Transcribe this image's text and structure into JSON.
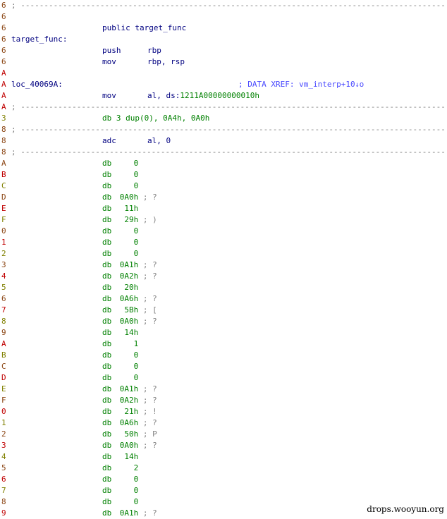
{
  "colors": {
    "seg_brown": "#8b4513",
    "seg_red": "#c00000",
    "seg_olive": "#808000",
    "text_navy": "#000080",
    "data_green": "#008000",
    "comment_blue": "#4a4aff",
    "separator_gray": "#808080"
  },
  "code_rows": [
    {
      "g": "6",
      "gc": "seg_brown",
      "sep": true
    },
    {
      "g": "6",
      "gc": "seg_brown"
    },
    {
      "g": "6",
      "gc": "seg_brown",
      "mn": "public target_func"
    },
    {
      "g": "6",
      "gc": "seg_brown",
      "label": "target_func:"
    },
    {
      "g": "6",
      "gc": "seg_brown",
      "mn": "push",
      "op": "rbp"
    },
    {
      "g": "6",
      "gc": "seg_brown",
      "mn": "mov",
      "op": "rbp, rsp"
    },
    {
      "g": "A",
      "gc": "seg_red"
    },
    {
      "g": "A",
      "gc": "seg_red",
      "label": "loc_40069A:",
      "comment": "; DATA XREF: vm_interp+10",
      "arrow": "↓",
      "comment_tail": "o"
    },
    {
      "g": "A",
      "gc": "seg_red",
      "mn": "mov",
      "op": "al, ds:",
      "opnum": "1211A00000000010h"
    },
    {
      "g": "A",
      "gc": "seg_red",
      "sep": true
    },
    {
      "g": "3",
      "gc": "seg_olive",
      "mn": "db 3 dup(0), 0A4h, 0A0h",
      "mncolor": "data_green"
    },
    {
      "g": "8",
      "gc": "seg_brown",
      "sep": true
    },
    {
      "g": "8",
      "gc": "seg_brown",
      "mn": "adc",
      "op": "al, 0"
    },
    {
      "g": "8",
      "gc": "seg_brown",
      "sep": true
    }
  ],
  "db_rows": [
    {
      "g": "A",
      "v": "0"
    },
    {
      "g": "B",
      "v": "0"
    },
    {
      "g": "C",
      "v": "0"
    },
    {
      "g": "D",
      "v": "0A0h",
      "c": "?"
    },
    {
      "g": "E",
      "v": "11h"
    },
    {
      "g": "F",
      "v": "29h",
      "c": ")"
    },
    {
      "g": "0",
      "v": "0"
    },
    {
      "g": "1",
      "v": "0"
    },
    {
      "g": "2",
      "v": "0"
    },
    {
      "g": "3",
      "v": "0A1h",
      "c": "?"
    },
    {
      "g": "4",
      "v": "0A2h",
      "c": "?"
    },
    {
      "g": "5",
      "v": "20h"
    },
    {
      "g": "6",
      "v": "0A6h",
      "c": "?"
    },
    {
      "g": "7",
      "v": "5Bh",
      "c": "["
    },
    {
      "g": "8",
      "v": "0A0h",
      "c": "?"
    },
    {
      "g": "9",
      "v": "14h"
    },
    {
      "g": "A",
      "v": "1"
    },
    {
      "g": "B",
      "v": "0"
    },
    {
      "g": "C",
      "v": "0"
    },
    {
      "g": "D",
      "v": "0"
    },
    {
      "g": "E",
      "v": "0A1h",
      "c": "?"
    },
    {
      "g": "F",
      "v": "0A2h",
      "c": "?"
    },
    {
      "g": "0",
      "v": "21h",
      "c": "!"
    },
    {
      "g": "1",
      "v": "0A6h",
      "c": "?"
    },
    {
      "g": "2",
      "v": "50h",
      "c": "P"
    },
    {
      "g": "3",
      "v": "0A0h",
      "c": "?"
    },
    {
      "g": "4",
      "v": "14h"
    },
    {
      "g": "5",
      "v": "2"
    },
    {
      "g": "6",
      "v": "0"
    },
    {
      "g": "7",
      "v": "0"
    },
    {
      "g": "8",
      "v": "0"
    },
    {
      "g": "9",
      "v": "0A1h",
      "c": "?"
    }
  ],
  "db_keyword": "db",
  "sep_prefix": ";",
  "watermark": "drops.wooyun.org"
}
